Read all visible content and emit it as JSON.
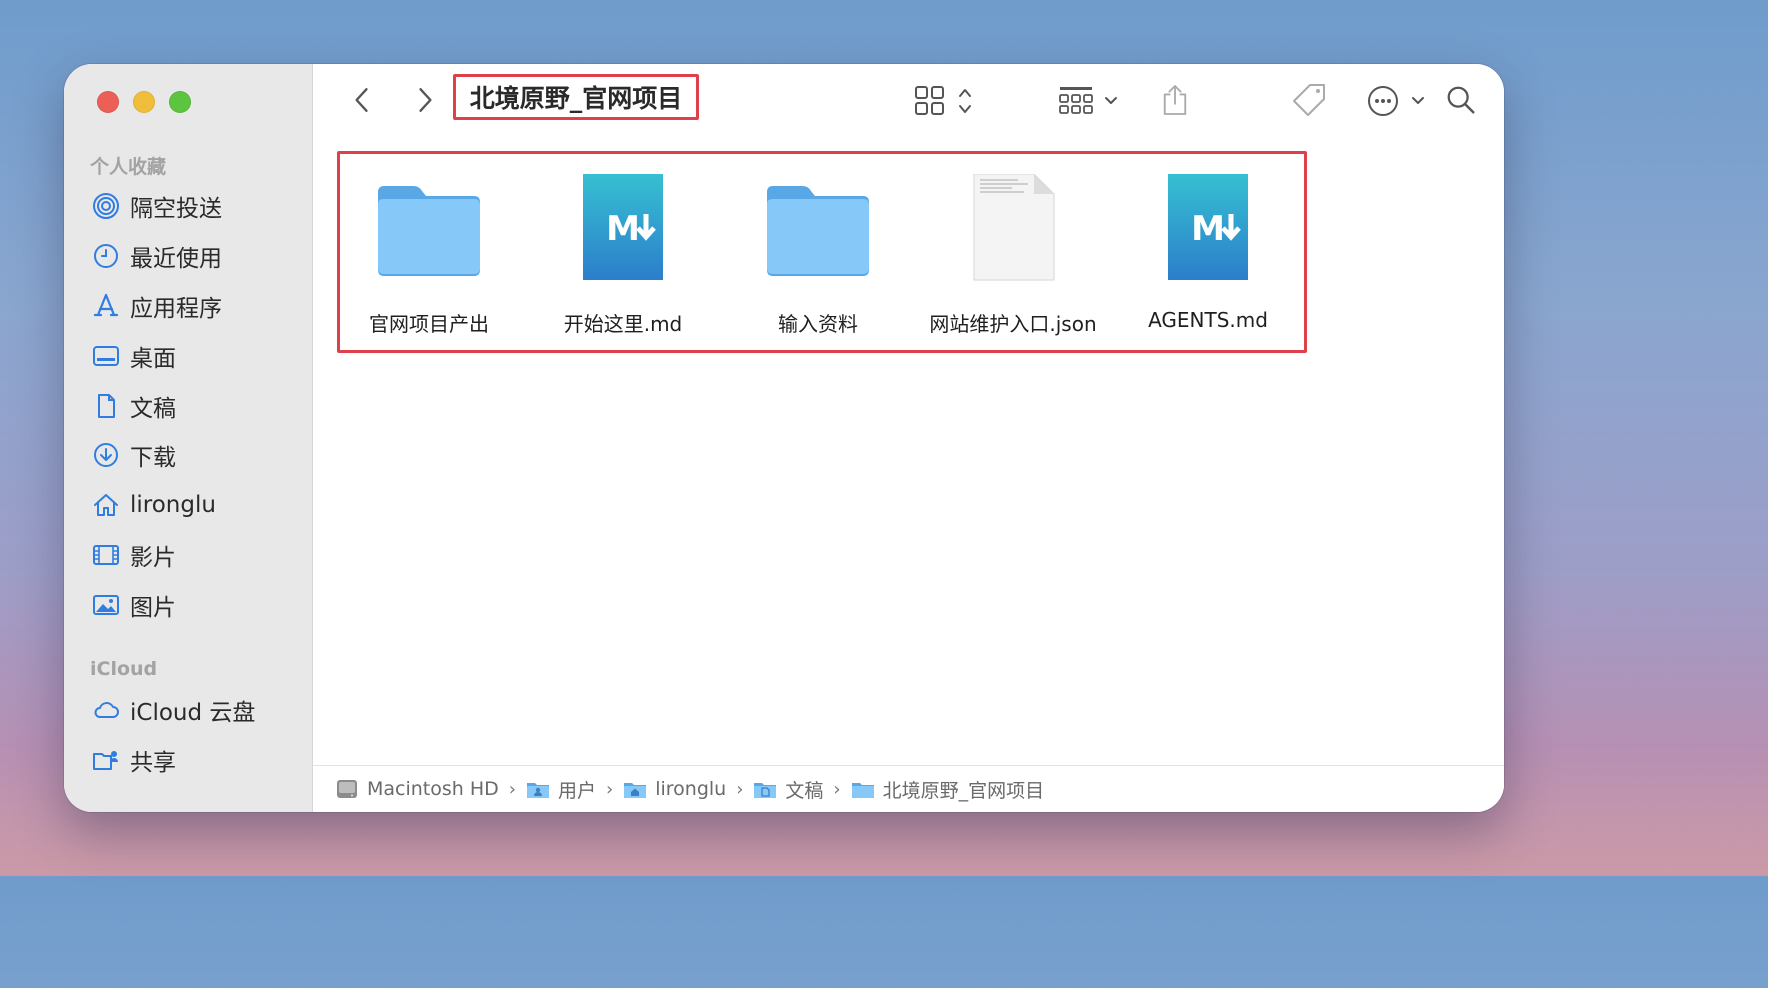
{
  "window": {
    "folder_title": "北境原野_官网项目"
  },
  "sidebar": {
    "favorites_title": "个人收藏",
    "favorites": [
      {
        "label": "隔空投送",
        "icon": "airdrop-icon"
      },
      {
        "label": "最近使用",
        "icon": "clock-icon"
      },
      {
        "label": "应用程序",
        "icon": "applications-icon"
      },
      {
        "label": "桌面",
        "icon": "desktop-icon"
      },
      {
        "label": "文稿",
        "icon": "document-icon"
      },
      {
        "label": "下载",
        "icon": "download-icon"
      },
      {
        "label": "lironglu",
        "icon": "home-icon"
      },
      {
        "label": "影片",
        "icon": "film-icon"
      },
      {
        "label": "图片",
        "icon": "photo-icon"
      }
    ],
    "icloud_title": "iCloud",
    "icloud": [
      {
        "label": "iCloud 云盘",
        "icon": "cloud-icon"
      },
      {
        "label": "共享",
        "icon": "shared-folder-icon"
      }
    ]
  },
  "files": [
    {
      "name": "官网项目产出",
      "kind": "folder"
    },
    {
      "name": "开始这里.md",
      "kind": "markdown"
    },
    {
      "name": "输入资料",
      "kind": "folder"
    },
    {
      "name": "网站维护入口.json",
      "kind": "document"
    },
    {
      "name": "AGENTS.md",
      "kind": "markdown"
    }
  ],
  "pathbar": [
    {
      "label": "Macintosh HD",
      "icon": "hard-drive-icon"
    },
    {
      "label": "用户",
      "icon": "users-folder-icon"
    },
    {
      "label": "lironglu",
      "icon": "home-folder-icon"
    },
    {
      "label": "文稿",
      "icon": "documents-folder-icon"
    },
    {
      "label": "北境原野_官网项目",
      "icon": "folder-icon"
    }
  ],
  "colors": {
    "accent": "#2f7de1",
    "highlight_border": "#e0404b",
    "folder_blue": "#7cc0f5",
    "markdown_teal": "#2aa9c9"
  }
}
